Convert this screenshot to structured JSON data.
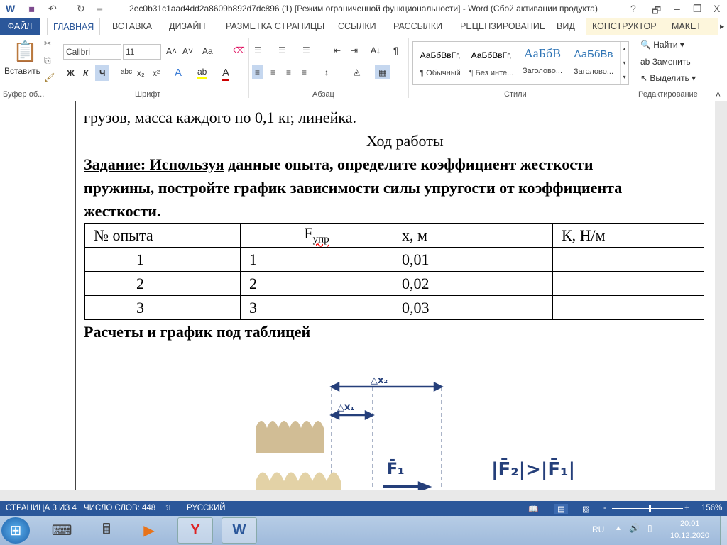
{
  "window": {
    "title": "2ec0b31c1aad4dd2a8609b892d7dc896 (1) [Режим ограниченной функциональности] - Word (Сбой активации продукта)",
    "help": "?",
    "restore": "🗗",
    "minimize": "–",
    "maximize": "❐",
    "close": "X"
  },
  "tabs": [
    "ФАЙЛ",
    "ГЛАВНАЯ",
    "ВСТАВКА",
    "ДИЗАЙН",
    "РАЗМЕТКА СТРАНИЦЫ",
    "ССЫЛКИ",
    "РАССЫЛКИ",
    "РЕЦЕНЗИРОВАНИЕ",
    "ВИД",
    "КОНСТРУКТОР",
    "МАКЕТ"
  ],
  "ribbon": {
    "clipboard": {
      "paste": "Вставить",
      "label": "Буфер об..."
    },
    "font": {
      "name": "Calibri",
      "size": "11",
      "grow": "A˄",
      "shrink": "A˅",
      "case": "Aa",
      "bold": "Ж",
      "italic": "К",
      "underline": "Ч",
      "strike": "abc",
      "sub": "x₂",
      "sup": "x²",
      "label": "Шрифт"
    },
    "paragraph": {
      "label": "Абзац",
      "sort": "А↓",
      "pilcrow": "¶"
    },
    "styles": {
      "items": [
        {
          "preview": "АаБбВвГг,",
          "name": "¶ Обычный"
        },
        {
          "preview": "АаБбВвГг,",
          "name": "¶ Без инте..."
        },
        {
          "preview": "АаБбВ",
          "name": "Заголово..."
        },
        {
          "preview": "АаБбВв",
          "name": "Заголово..."
        }
      ],
      "label": "Стили"
    },
    "editing": {
      "find": "Найти",
      "replace": "Заменить",
      "select": "Выделить",
      "label": "Редактирование"
    }
  },
  "document": {
    "line1": "грузов, масса каждого по 0,1 кг, линейка.",
    "heading": "Ход работы",
    "task_label": "Задание:  Используя",
    "task_rest": " данные опыта, определите коэффициент жесткости",
    "task_line2": "пружины, постройте график зависимости  силы упругости от коэффициента",
    "task_line3": "жесткости.",
    "table": {
      "headers": [
        "№ опыта",
        "F",
        "упр",
        "x, м",
        "К, Н/м"
      ],
      "rows": [
        [
          "1",
          "1",
          "0,01",
          ""
        ],
        [
          "2",
          "2",
          "0,02",
          ""
        ],
        [
          "3",
          "3",
          "0,03",
          ""
        ]
      ]
    },
    "after": "Расчеты и график под таблицей",
    "figure": {
      "dx2": "△x₂",
      "dx1": "△x₁",
      "f1": "F̄₁",
      "relation": "|F̄₂|>|F̄₁|"
    }
  },
  "status": {
    "page": "СТРАНИЦА 3 ИЗ 4",
    "words": "ЧИСЛО СЛОВ: 448",
    "lang": "РУССКИЙ",
    "zoom": "156%",
    "zoom_minus": "-",
    "zoom_plus": "+"
  },
  "taskbar": {
    "lang": "RU",
    "time": "20:01",
    "date": "10.12.2020"
  }
}
